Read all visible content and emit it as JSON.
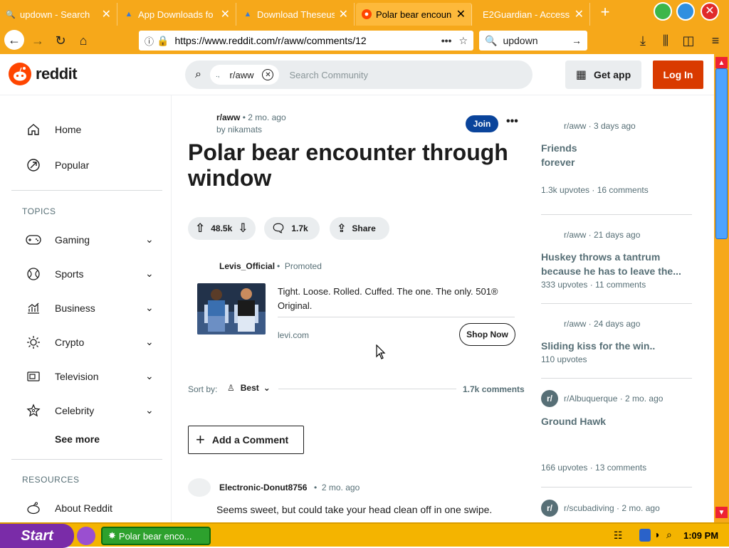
{
  "browser": {
    "tabs": [
      {
        "label": "updown - Search",
        "icon": "search-icon"
      },
      {
        "label": "App Downloads fo",
        "icon": "download-icon"
      },
      {
        "label": "Download Theseus",
        "icon": "download-icon"
      },
      {
        "label": "Polar bear encoun",
        "icon": "reddit-icon"
      },
      {
        "label": "E2Guardian - Access",
        "icon": "shield-icon"
      }
    ],
    "url": "https://www.reddit.com/r/aww/comments/12",
    "search_value": "updown"
  },
  "header": {
    "logo_text": "reddit",
    "chip_label": "r/aww",
    "search_placeholder": "Search Community",
    "get_app": "Get app",
    "login": "Log In"
  },
  "sidebar": {
    "nav": [
      {
        "label": "Home",
        "icon": "home-icon"
      },
      {
        "label": "Popular",
        "icon": "popular-icon"
      }
    ],
    "topics_heading": "TOPICS",
    "topics": [
      {
        "label": "Gaming",
        "icon": "gamepad-icon"
      },
      {
        "label": "Sports",
        "icon": "ball-icon"
      },
      {
        "label": "Business",
        "icon": "chart-icon"
      },
      {
        "label": "Crypto",
        "icon": "crypto-icon"
      },
      {
        "label": "Television",
        "icon": "tv-icon"
      },
      {
        "label": "Celebrity",
        "icon": "star-icon"
      }
    ],
    "see_more": "See more",
    "resources_heading": "RESOURCES",
    "resources": [
      {
        "label": "About Reddit",
        "icon": "about-icon"
      }
    ]
  },
  "post": {
    "subreddit": "r/aww",
    "age": "2 mo. ago",
    "author": "by nikamats",
    "join": "Join",
    "title": "Polar bear encounter through window",
    "votes": "48.5k",
    "comments": "1.7k",
    "share": "Share"
  },
  "promo": {
    "user": "Levis_Official",
    "tag": "Promoted",
    "text": "Tight. Loose. Rolled. Cuffed. The one. The only. 501® Original.",
    "domain": "levi.com",
    "cta": "Shop Now"
  },
  "comments_section": {
    "sort_label": "Sort by:",
    "sort_value": "Best",
    "count": "1.7k comments",
    "add_comment": "Add a Comment",
    "first": {
      "user": "Electronic-Donut8756",
      "age": "2 mo. ago",
      "text": "Seems sweet, but could take your head clean off in one swipe."
    }
  },
  "related": [
    {
      "meta": "r/aww · 3 days ago",
      "title": "Friends forever",
      "stats": "1.3k upvotes · 16 comments"
    },
    {
      "meta": "r/aww · 21 days ago",
      "title": "Huskey throws a tantrum because he has to leave the...",
      "stats": "333 upvotes · 11 comments"
    },
    {
      "meta": "r/aww · 24 days ago",
      "title": "Sliding kiss for the win..",
      "stats": "110 upvotes"
    },
    {
      "meta": "r/Albuquerque · 2 mo. ago",
      "title": "Ground Hawk",
      "stats": "166 upvotes · 13 comments"
    },
    {
      "meta": "r/scubadiving · 2 mo. ago",
      "title": "",
      "stats": ""
    }
  ],
  "taskbar": {
    "start": "Start",
    "task": "Polar bear enco...",
    "clock": "1:09 PM"
  }
}
